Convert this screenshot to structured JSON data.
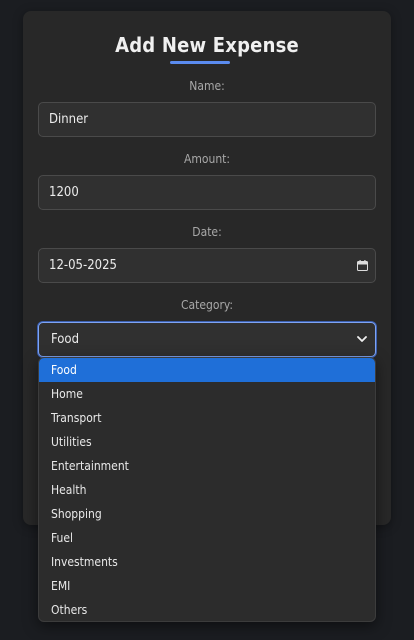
{
  "form": {
    "title": "Add New Expense",
    "name_label": "Name:",
    "name_value": "Dinner",
    "amount_label": "Amount:",
    "amount_value": "1200",
    "date_label": "Date:",
    "date_value": "12-05-2025",
    "category_label": "Category:",
    "category_value": "Food"
  },
  "dropdown": {
    "options": [
      "Food",
      "Home",
      "Transport",
      "Utilities",
      "Entertainment",
      "Health",
      "Shopping",
      "Fuel",
      "Investments",
      "EMI",
      "Others"
    ],
    "selected_index": 0
  },
  "colors": {
    "accent": "#5b8cf0",
    "selected_option": "#1f6fd8",
    "card": "#282828",
    "background": "#1b1d21"
  },
  "icons": {
    "date": "calendar-icon",
    "category": "chevron-down-icon"
  }
}
